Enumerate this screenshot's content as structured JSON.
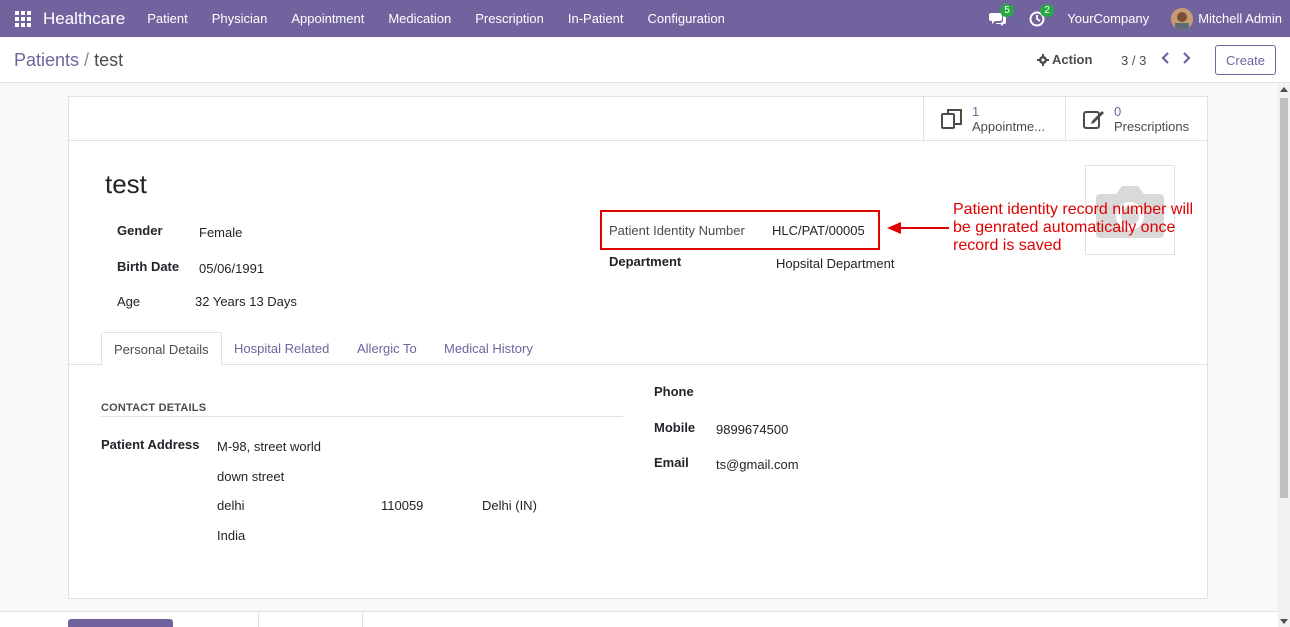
{
  "navbar": {
    "brand": "Healthcare",
    "menu": [
      "Patient",
      "Physician",
      "Appointment",
      "Medication",
      "Prescription",
      "In-Patient",
      "Configuration"
    ],
    "messages_badge": "5",
    "activities_badge": "2",
    "company": "YourCompany",
    "user": "Mitchell Admin",
    "color": "#71639e"
  },
  "control_panel": {
    "breadcrumb_parent": "Patients",
    "breadcrumb_separator": " / ",
    "breadcrumb_current": "test",
    "action_label": "Action",
    "pager": "3 / 3",
    "create_label": "Create"
  },
  "smart_buttons": [
    {
      "count": "1",
      "label": "Appointme...",
      "icon": "copy-icon"
    },
    {
      "count": "0",
      "label": "Prescriptions",
      "icon": "edit-icon"
    }
  ],
  "record": {
    "name": "test",
    "gender_label": "Gender",
    "gender": "Female",
    "birth_date_label": "Birth Date",
    "birth_date": "05/06/1991",
    "age_label": "Age",
    "age": "32 Years 13 Days",
    "identity_label": "Patient Identity Number",
    "identity": "HLC/PAT/00005",
    "department_label": "Department",
    "department": "Hopsital Department"
  },
  "annotation": {
    "text": "Patient identity record number will be genrated automatically once record is saved",
    "color": "#e00000"
  },
  "tabs": [
    "Personal Details",
    "Hospital Related",
    "Allergic To",
    "Medical History"
  ],
  "contact": {
    "section_title": "CONTACT DETAILS",
    "address_label": "Patient Address",
    "street": "M-98, street world",
    "street2": "down street",
    "city": "delhi",
    "zip": "110059",
    "state": "Delhi (IN)",
    "country": "India",
    "phone_label": "Phone",
    "phone": "",
    "mobile_label": "Mobile",
    "mobile": "9899674500",
    "email_label": "Email",
    "email": "ts@gmail.com"
  }
}
